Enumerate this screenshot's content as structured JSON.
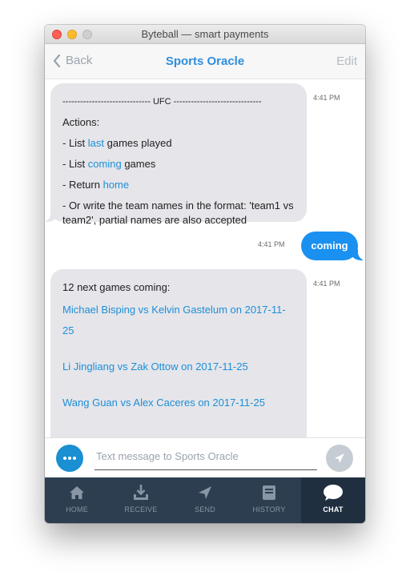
{
  "window": {
    "title": "Byteball — smart payments"
  },
  "nav": {
    "back": "Back",
    "title": "Sports Oracle",
    "edit": "Edit"
  },
  "messages": [
    {
      "side": "in",
      "time": "4:41 PM",
      "header": "------------------------------ UFC ------------------------------",
      "actions_label": "Actions:",
      "items": [
        {
          "prefix": "- List ",
          "link": "last",
          "suffix": " games played"
        },
        {
          "prefix": "- List ",
          "link": "coming",
          "suffix": " games"
        },
        {
          "prefix": "- Return ",
          "link": "home",
          "suffix": ""
        }
      ],
      "note": "- Or write the team names in the format: 'team1 vs team2', partial names are also accepted"
    },
    {
      "side": "out",
      "time": "4:41 PM",
      "text": "coming"
    },
    {
      "side": "in",
      "time": "4:41 PM",
      "header": "12 next games coming:",
      "games": [
        "Michael Bisping vs Kelvin Gastelum on 2017-11-25",
        "Li Jingliang vs Zak Ottow on 2017-11-25",
        "Wang Guan vs Alex Caceres on 2017-11-25"
      ]
    }
  ],
  "composer": {
    "placeholder": "Text message to Sports Oracle"
  },
  "tabs": [
    {
      "label": "HOME",
      "icon": "home-icon"
    },
    {
      "label": "RECEIVE",
      "icon": "receive-icon"
    },
    {
      "label": "SEND",
      "icon": "send-icon"
    },
    {
      "label": "HISTORY",
      "icon": "history-icon"
    },
    {
      "label": "CHAT",
      "icon": "chat-icon",
      "active": true
    }
  ],
  "colors": {
    "accent": "#1a90f0",
    "link": "#1d8fd6",
    "tabbar": "#2c3e50",
    "tabbar_active": "#1f2f3f"
  }
}
